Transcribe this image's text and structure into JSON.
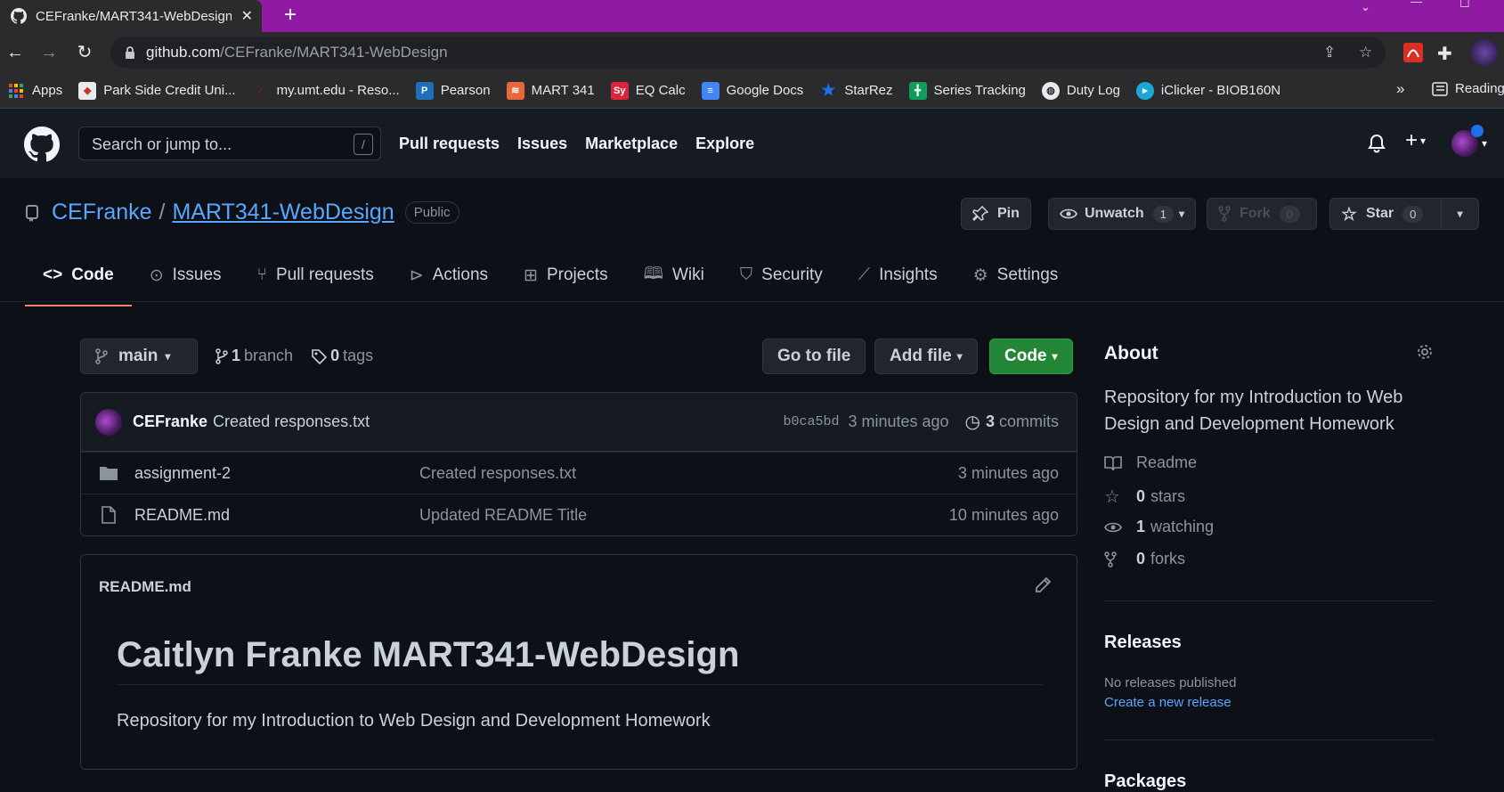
{
  "browser": {
    "tab_title": "CEFranke/MART341-WebDesign",
    "url_host": "github.com",
    "url_path": "/CEFranke/MART341-WebDesign",
    "bookmarks": [
      {
        "label": "Apps",
        "color": "#ea4335"
      },
      {
        "label": "Park Side Credit Uni...",
        "color": "#e8eaed"
      },
      {
        "label": "my.umt.edu - Reso...",
        "color": "#7a1d1d"
      },
      {
        "label": "Pearson",
        "color": "#1e6fb5"
      },
      {
        "label": "MART 341",
        "color": "#e8663c"
      },
      {
        "label": "EQ Calc",
        "color": "#d7263d"
      },
      {
        "label": "Google Docs",
        "color": "#4285f4"
      },
      {
        "label": "StarRez",
        "color": "#1a73e8"
      },
      {
        "label": "Series Tracking",
        "color": "#0f9d58"
      },
      {
        "label": "Duty Log",
        "color": "#e8eaed"
      },
      {
        "label": "iClicker - BIOB160N",
        "color": "#1ba7d8"
      }
    ],
    "bookmarks_overflow": "»",
    "reading_list": "Reading"
  },
  "github": {
    "search_placeholder": "Search or jump to...",
    "search_key": "/",
    "nav": [
      "Pull requests",
      "Issues",
      "Marketplace",
      "Explore"
    ]
  },
  "repo": {
    "owner": "CEFranke",
    "separator": "/",
    "name": "MART341-WebDesign",
    "visibility": "Public",
    "pin_label": "Pin",
    "unwatch_label": "Unwatch",
    "unwatch_count": "1",
    "fork_label": "Fork",
    "fork_count": "0",
    "star_label": "Star",
    "star_count": "0",
    "tabs": [
      "Code",
      "Issues",
      "Pull requests",
      "Actions",
      "Projects",
      "Wiki",
      "Security",
      "Insights",
      "Settings"
    ],
    "selected_tab": "Code"
  },
  "files": {
    "branch": "main",
    "branch_count": "1",
    "branch_word": "branch",
    "tag_count": "0",
    "tag_word": "tags",
    "go_to_file": "Go to file",
    "add_file": "Add file",
    "code": "Code",
    "last_commit": {
      "author": "CEFranke",
      "message": "Created responses.txt",
      "sha": "b0ca5bd",
      "age": "3 minutes ago",
      "commit_count": "3",
      "commit_word": "commits"
    },
    "rows": [
      {
        "name": "assignment-2",
        "type": "folder",
        "message": "Created responses.txt",
        "age": "3 minutes ago"
      },
      {
        "name": "README.md",
        "type": "file",
        "message": "Updated README Title",
        "age": "10 minutes ago"
      }
    ]
  },
  "readme": {
    "filename": "README.md",
    "heading": "Caitlyn Franke MART341-WebDesign",
    "body": "Repository for my Introduction to Web Design and Development Homework"
  },
  "about": {
    "heading": "About",
    "description": "Repository for my Introduction to Web Design and Development Homework",
    "readme": "Readme",
    "stars_count": "0",
    "stars_word": "stars",
    "watching_count": "1",
    "watching_word": "watching",
    "forks_count": "0",
    "forks_word": "forks",
    "releases_heading": "Releases",
    "releases_none": "No releases published",
    "releases_create": "Create a new release",
    "packages_heading": "Packages"
  },
  "colors": {
    "tabstrip": "#8e1ba2",
    "page_bg": "#0d1117",
    "header_bg": "#161b22",
    "link": "#58a6ff",
    "code_button": "#238636",
    "tab_underline": "#f78166"
  }
}
